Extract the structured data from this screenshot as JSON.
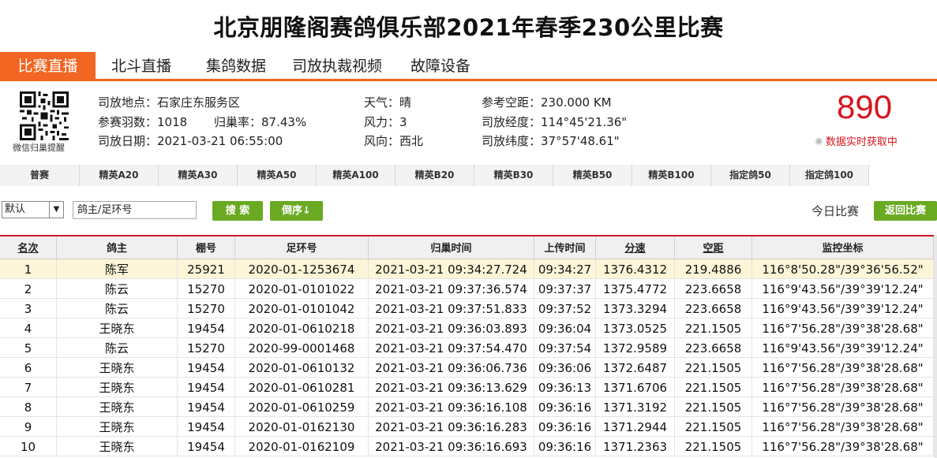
{
  "title": "北京朋隆阁赛鸽俱乐部2021年春季230公里比赛",
  "nav": [
    "比赛直播",
    "北斗直播",
    "集鸽数据",
    "司放执裁视频",
    "故障设备"
  ],
  "qr_caption": "微信归巢提醒",
  "info": {
    "place_label": "司放地点：",
    "place": "石家庄东服务区",
    "count_label": "参赛羽数：",
    "count": "1018",
    "return_label": "归巢率：",
    "return_rate": "87.43%",
    "date_label": "司放日期：",
    "date": "2021-03-21 06:55:00",
    "weather_label": "天气：",
    "weather": "晴",
    "wind_label": "风力：",
    "wind": "3",
    "dir_label": "风向：",
    "dir": "西北",
    "dist_label": "参考空距：",
    "dist": "230.000 KM",
    "lon_label": "司放经度：",
    "lon": "114°45'21.36\"",
    "lat_label": "司放纬度：",
    "lat": "37°57'48.61\""
  },
  "returned_count": "890",
  "live_text": "数据实时获取中",
  "categories": [
    "普赛",
    "精英A20",
    "精英A30",
    "精英A50",
    "精英A100",
    "精英B20",
    "精英B30",
    "精英B50",
    "精英B100",
    "指定鸽50",
    "指定鸽100"
  ],
  "filters": {
    "sort_value": "默认",
    "search_value": "鸽主/足环号",
    "search_btn": "搜 索",
    "reverse_btn": "倒序↓",
    "today": "今日比赛",
    "back_btn": "返回比赛"
  },
  "columns": [
    "名次",
    "鸽主",
    "棚号",
    "足环号",
    "归巢时间",
    "上传时间",
    "分速",
    "空距",
    "监控坐标"
  ],
  "rows": [
    [
      "1",
      "陈军",
      "25921",
      "2020-01-1253674",
      "2021-03-21 09:34:27.724",
      "09:34:27",
      "1376.4312",
      "219.4886",
      "116°8'50.28\"/39°36'56.52\""
    ],
    [
      "2",
      "陈云",
      "15270",
      "2020-01-0101022",
      "2021-03-21 09:37:36.574",
      "09:37:37",
      "1375.4772",
      "223.6658",
      "116°9'43.56\"/39°39'12.24\""
    ],
    [
      "3",
      "陈云",
      "15270",
      "2020-01-0101042",
      "2021-03-21 09:37:51.833",
      "09:37:52",
      "1373.3294",
      "223.6658",
      "116°9'43.56\"/39°39'12.24\""
    ],
    [
      "4",
      "王晓东",
      "19454",
      "2020-01-0610218",
      "2021-03-21 09:36:03.893",
      "09:36:04",
      "1373.0525",
      "221.1505",
      "116°7'56.28\"/39°38'28.68\""
    ],
    [
      "5",
      "陈云",
      "15270",
      "2020-99-0001468",
      "2021-03-21 09:37:54.470",
      "09:37:54",
      "1372.9589",
      "223.6658",
      "116°9'43.56\"/39°39'12.24\""
    ],
    [
      "6",
      "王晓东",
      "19454",
      "2020-01-0610132",
      "2021-03-21 09:36:06.736",
      "09:36:06",
      "1372.6487",
      "221.1505",
      "116°7'56.28\"/39°38'28.68\""
    ],
    [
      "7",
      "王晓东",
      "19454",
      "2020-01-0610281",
      "2021-03-21 09:36:13.629",
      "09:36:13",
      "1371.6706",
      "221.1505",
      "116°7'56.28\"/39°38'28.68\""
    ],
    [
      "8",
      "王晓东",
      "19454",
      "2020-01-0610259",
      "2021-03-21 09:36:16.108",
      "09:36:16",
      "1371.3192",
      "221.1505",
      "116°7'56.28\"/39°38'28.68\""
    ],
    [
      "9",
      "王晓东",
      "19454",
      "2020-01-0162130",
      "2021-03-21 09:36:16.283",
      "09:36:16",
      "1371.2944",
      "221.1505",
      "116°7'56.28\"/39°38'28.68\""
    ],
    [
      "10",
      "王晓东",
      "19454",
      "2020-01-0162109",
      "2021-03-21 09:36:16.693",
      "09:36:16",
      "1371.2363",
      "221.1505",
      "116°7'56.28\"/39°38'28.68\""
    ]
  ]
}
